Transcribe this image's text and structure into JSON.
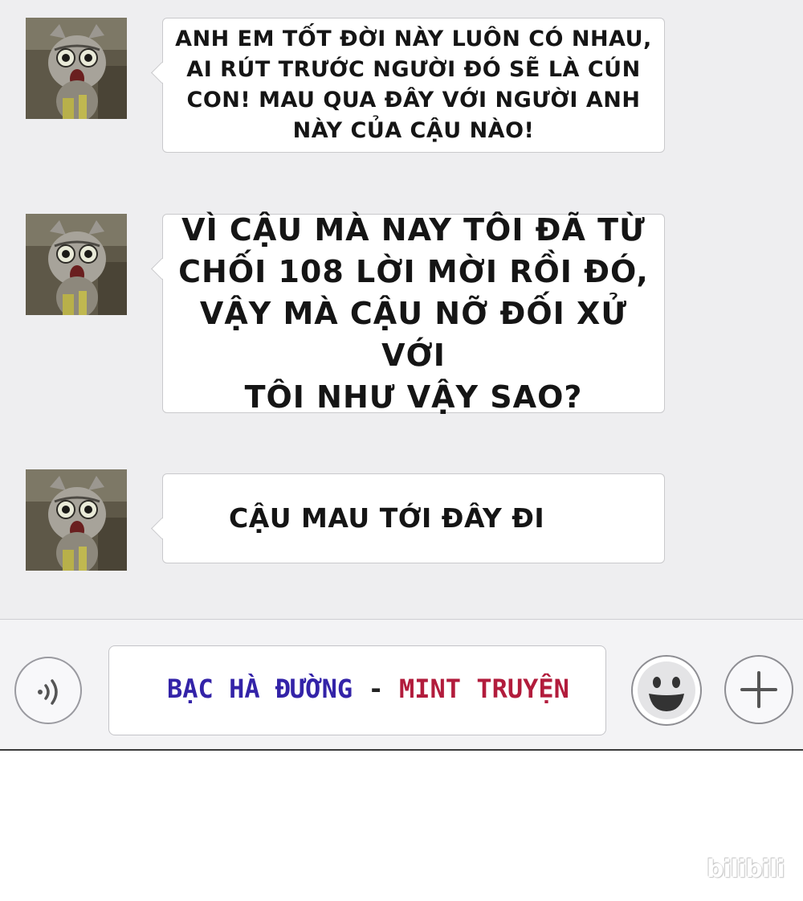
{
  "messages": [
    {
      "text": "ANH EM TỐT ĐỜI NÀY LUÔN CÓ NHAU,\nAI RÚT TRƯỚC NGƯỜI ĐÓ SẼ LÀ CÚN\nCON! MAU QUA ĐÂY VỚI NGƯỜI ANH\nNÀY CỦA CẬU NÀO!"
    },
    {
      "text": "VÌ CẬU MÀ NAY TÔI ĐÃ TỪ\nCHỐI 108 LỜI MỜI RỒI ĐÓ,\nVẬY MÀ CẬU NỠ ĐỐI XỬ VỚI\nTÔI NHƯ VẬY SAO?"
    },
    {
      "text": "CẬU MAU TỚI ĐÂY ĐI"
    }
  ],
  "input_bar": {
    "value_part1": "BẠC HÀ ĐƯỜNG",
    "value_sep": " - ",
    "value_part2": "MINT TRUYỆN",
    "icons": {
      "left": "voice-icon",
      "smile": "smiley-face-icon",
      "add": "plus-icon"
    }
  },
  "watermark": "bilibili",
  "colors": {
    "chat_background": "#eeeef0",
    "credit_blue": "#3323a8",
    "credit_red": "#b21c3c"
  }
}
